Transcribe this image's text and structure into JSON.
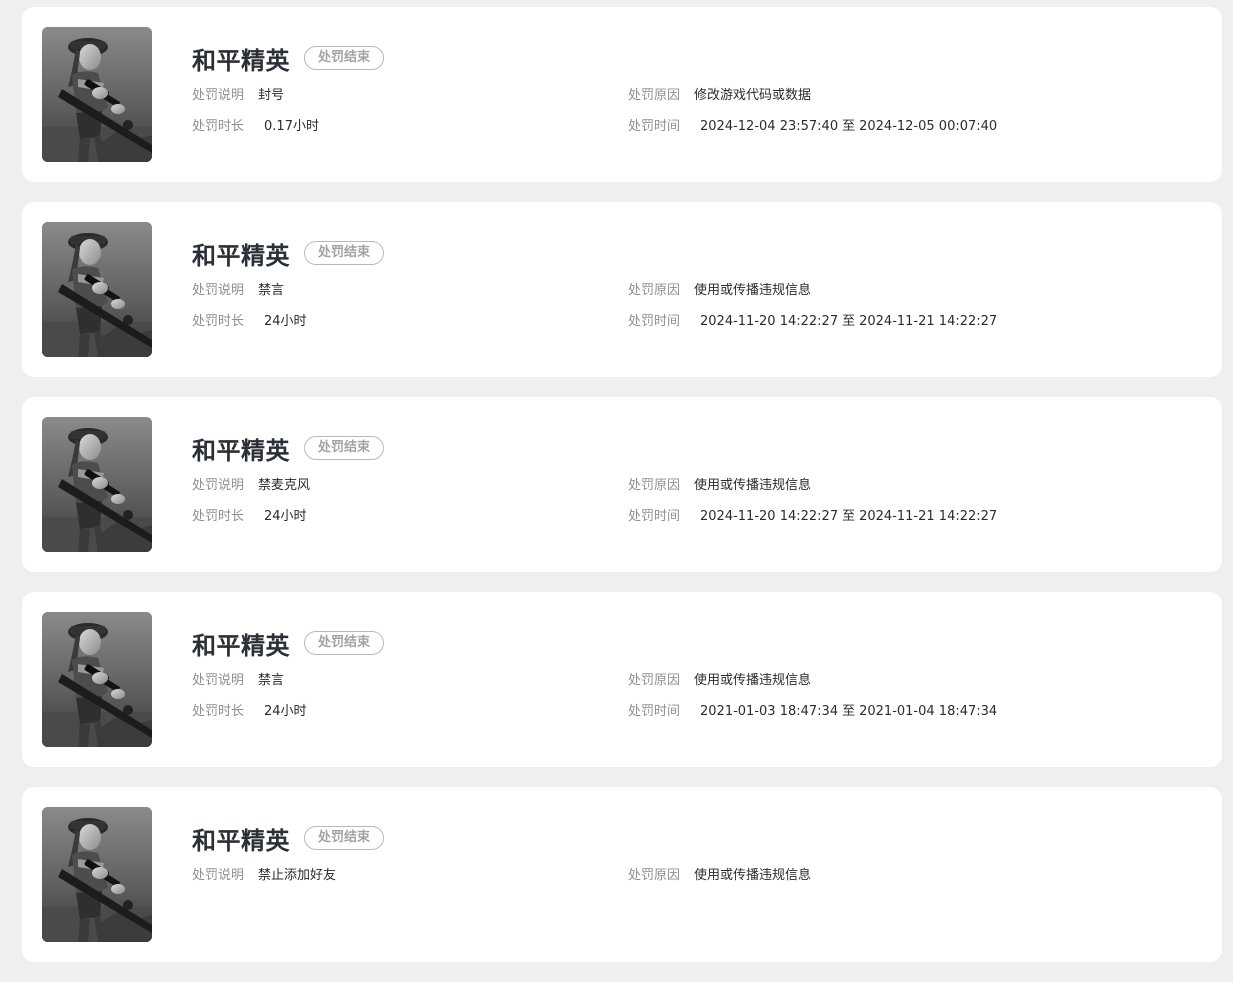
{
  "labels": {
    "desc": "处罚说明",
    "reason": "处罚原因",
    "duration": "处罚时长",
    "time": "处罚时间",
    "time_sep": "至"
  },
  "colors": {
    "background": "#efefef",
    "card": "#ffffff",
    "title": "#2b2f36",
    "label": "#8f8f8f",
    "badge": "#a3a3a3"
  },
  "records": [
    {
      "game": "和平精英",
      "status": "处罚结束",
      "desc": "封号",
      "reason": "修改游戏代码或数据",
      "duration": "0.17小时",
      "start": "2024-12-04 23:57:40",
      "end": "2024-12-05 00:07:40"
    },
    {
      "game": "和平精英",
      "status": "处罚结束",
      "desc": "禁言",
      "reason": "使用或传播违规信息",
      "duration": "24小时",
      "start": "2024-11-20 14:22:27",
      "end": "2024-11-21 14:22:27"
    },
    {
      "game": "和平精英",
      "status": "处罚结束",
      "desc": "禁麦克风",
      "reason": "使用或传播违规信息",
      "duration": "24小时",
      "start": "2024-11-20 14:22:27",
      "end": "2024-11-21 14:22:27"
    },
    {
      "game": "和平精英",
      "status": "处罚结束",
      "desc": "禁言",
      "reason": "使用或传播违规信息",
      "duration": "24小时",
      "start": "2021-01-03 18:47:34",
      "end": "2021-01-04 18:47:34"
    },
    {
      "game": "和平精英",
      "status": "处罚结束",
      "desc": "禁止添加好友",
      "reason": "使用或传播违规信息",
      "duration": "",
      "start": "",
      "end": ""
    }
  ]
}
